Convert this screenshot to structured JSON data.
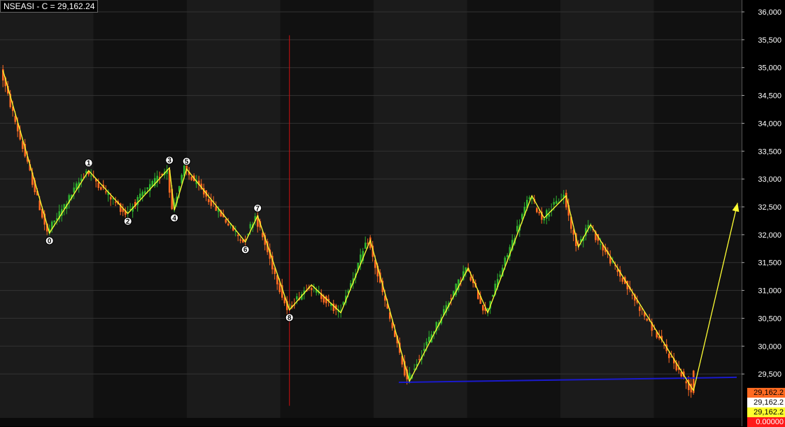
{
  "header": {
    "title": "NSEASI - C = 29,162.24"
  },
  "value_boxes": [
    {
      "text": "29,162.2",
      "bg": "#ff6a21",
      "fg": "#000000"
    },
    {
      "text": "29,162.2",
      "bg": "#ffffff",
      "fg": "#000000"
    },
    {
      "text": "29,162.2",
      "bg": "#ffff2e",
      "fg": "#000000"
    },
    {
      "text": "0.00000",
      "bg": "#ff1a1a",
      "fg": "#ffffff"
    }
  ],
  "colors": {
    "background": "#000000",
    "band_light": "#1b1b1b",
    "band_dark": "#111111",
    "grid": "#333333",
    "bull": "#2fb32f",
    "bear": "#ff6a21",
    "wave_line": "#ffff33",
    "support_line": "#1a1acc",
    "vline": "#cc1111"
  },
  "chart_data": {
    "type": "candlestick",
    "title": "NSEASI - C = 29,162.24",
    "series": [
      {
        "name": "NSEASI",
        "last_close": 29162.24
      }
    ],
    "ylim": [
      28800,
      36200
    ],
    "y_ticks": [
      29500,
      30000,
      30500,
      31000,
      31500,
      32000,
      32500,
      33000,
      33500,
      34000,
      34500,
      35000,
      35500,
      36000
    ],
    "y_tick_labels": [
      "29,500",
      "30,000",
      "30,500",
      "31,000",
      "31,500",
      "32,000",
      "32,500",
      "33,000",
      "33,500",
      "34,000",
      "34,500",
      "35,000",
      "35,500",
      "36,000"
    ],
    "grid": true,
    "wave_points": [
      {
        "i": 0,
        "value": 34950,
        "label": ""
      },
      {
        "i": 19,
        "value": 32030,
        "label": "0"
      },
      {
        "i": 35,
        "value": 33150,
        "label": "1"
      },
      {
        "i": 51,
        "value": 32380,
        "label": "2"
      },
      {
        "i": 68,
        "value": 33200,
        "label": "3"
      },
      {
        "i": 70,
        "value": 32440,
        "label": "4"
      },
      {
        "i": 75,
        "value": 33180,
        "label": "5"
      },
      {
        "i": 99,
        "value": 31870,
        "label": "6"
      },
      {
        "i": 104,
        "value": 32340,
        "label": "7"
      },
      {
        "i": 117,
        "value": 30650,
        "label": "8"
      },
      {
        "i": 126,
        "value": 31100,
        "label": ""
      },
      {
        "i": 138,
        "value": 30600,
        "label": ""
      },
      {
        "i": 150,
        "value": 31900,
        "label": ""
      },
      {
        "i": 166,
        "value": 29370,
        "label": ""
      },
      {
        "i": 190,
        "value": 31400,
        "label": ""
      },
      {
        "i": 198,
        "value": 30600,
        "label": ""
      },
      {
        "i": 216,
        "value": 32700,
        "label": ""
      },
      {
        "i": 221,
        "value": 32300,
        "label": ""
      },
      {
        "i": 230,
        "value": 32700,
        "label": ""
      },
      {
        "i": 235,
        "value": 31780,
        "label": ""
      },
      {
        "i": 240,
        "value": 32180,
        "label": ""
      },
      {
        "i": 282,
        "value": 29200,
        "label": ""
      }
    ],
    "projection": {
      "from": {
        "i": 282,
        "value": 29200
      },
      "to": {
        "i": 300,
        "value": 32570
      }
    },
    "support_line": {
      "start": {
        "i": 162,
        "value": 29350
      },
      "end": {
        "i": 300,
        "value": 29440
      }
    },
    "vertical_line": {
      "i": 117,
      "high": 35580,
      "low": 28930
    },
    "total_bars": 302
  }
}
